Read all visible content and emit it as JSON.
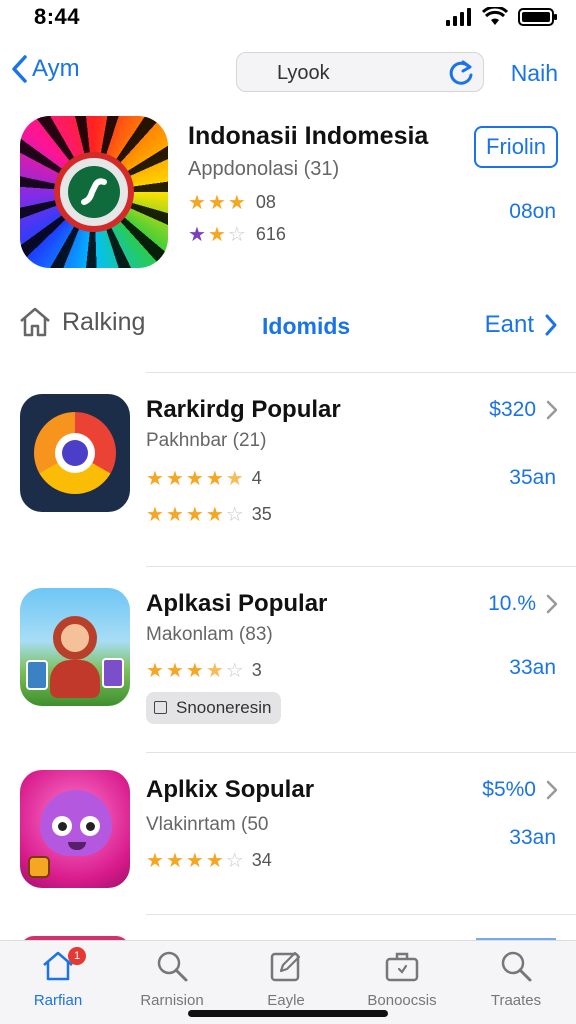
{
  "status_bar": {
    "time": "8:44"
  },
  "nav": {
    "back_label": "Aym",
    "search_value": "Lyook",
    "next_label": "Naih"
  },
  "featured": {
    "title": "Indonasii Indomesia",
    "subtitle": "Appdonolasi (31)",
    "rating1_text": "08",
    "rating1_stars": 3,
    "rating2_text": "616",
    "rating2_stars": 2,
    "get_label": "Friolin",
    "size": "08on"
  },
  "tabs": {
    "ranking_label": "Ralking",
    "middle_label": "Idomids",
    "end_label": "Eant"
  },
  "items": [
    {
      "title": "Rarkirdg Popular",
      "subtitle": "Pakhnbar (21)",
      "rating1_text": "4",
      "rating1_stars": 4.5,
      "rating2_text": "35",
      "rating2_stars": 4,
      "price": "$320",
      "size": "35an",
      "icon": "chrome-icon"
    },
    {
      "title": "Aplkasi Popular",
      "subtitle": "Makonlam (83)",
      "rating1_text": "3",
      "rating1_stars": 3.5,
      "price": "10.%",
      "size": "33an",
      "tag": "Snooneresin",
      "icon": "game-character-icon"
    },
    {
      "title": "Aplkix Sopular",
      "subtitle": "Vlakinrtam (50",
      "rating1_text": "34",
      "rating1_stars": 4,
      "price": "$5%0",
      "size": "33an",
      "icon": "purple-monster-icon"
    }
  ],
  "tabbar": {
    "items": [
      {
        "label": "Rarfian",
        "icon": "home-icon",
        "active": true,
        "badge": "1"
      },
      {
        "label": "Rarnision",
        "icon": "search-icon"
      },
      {
        "label": "Eayle",
        "icon": "edit-icon"
      },
      {
        "label": "Bonoocsis",
        "icon": "briefcase-icon"
      },
      {
        "label": "Traates",
        "icon": "search-icon"
      }
    ]
  },
  "colors": {
    "accent": "#1a73e8",
    "star": "#f5a623",
    "star_off": "#c9c9c9"
  }
}
